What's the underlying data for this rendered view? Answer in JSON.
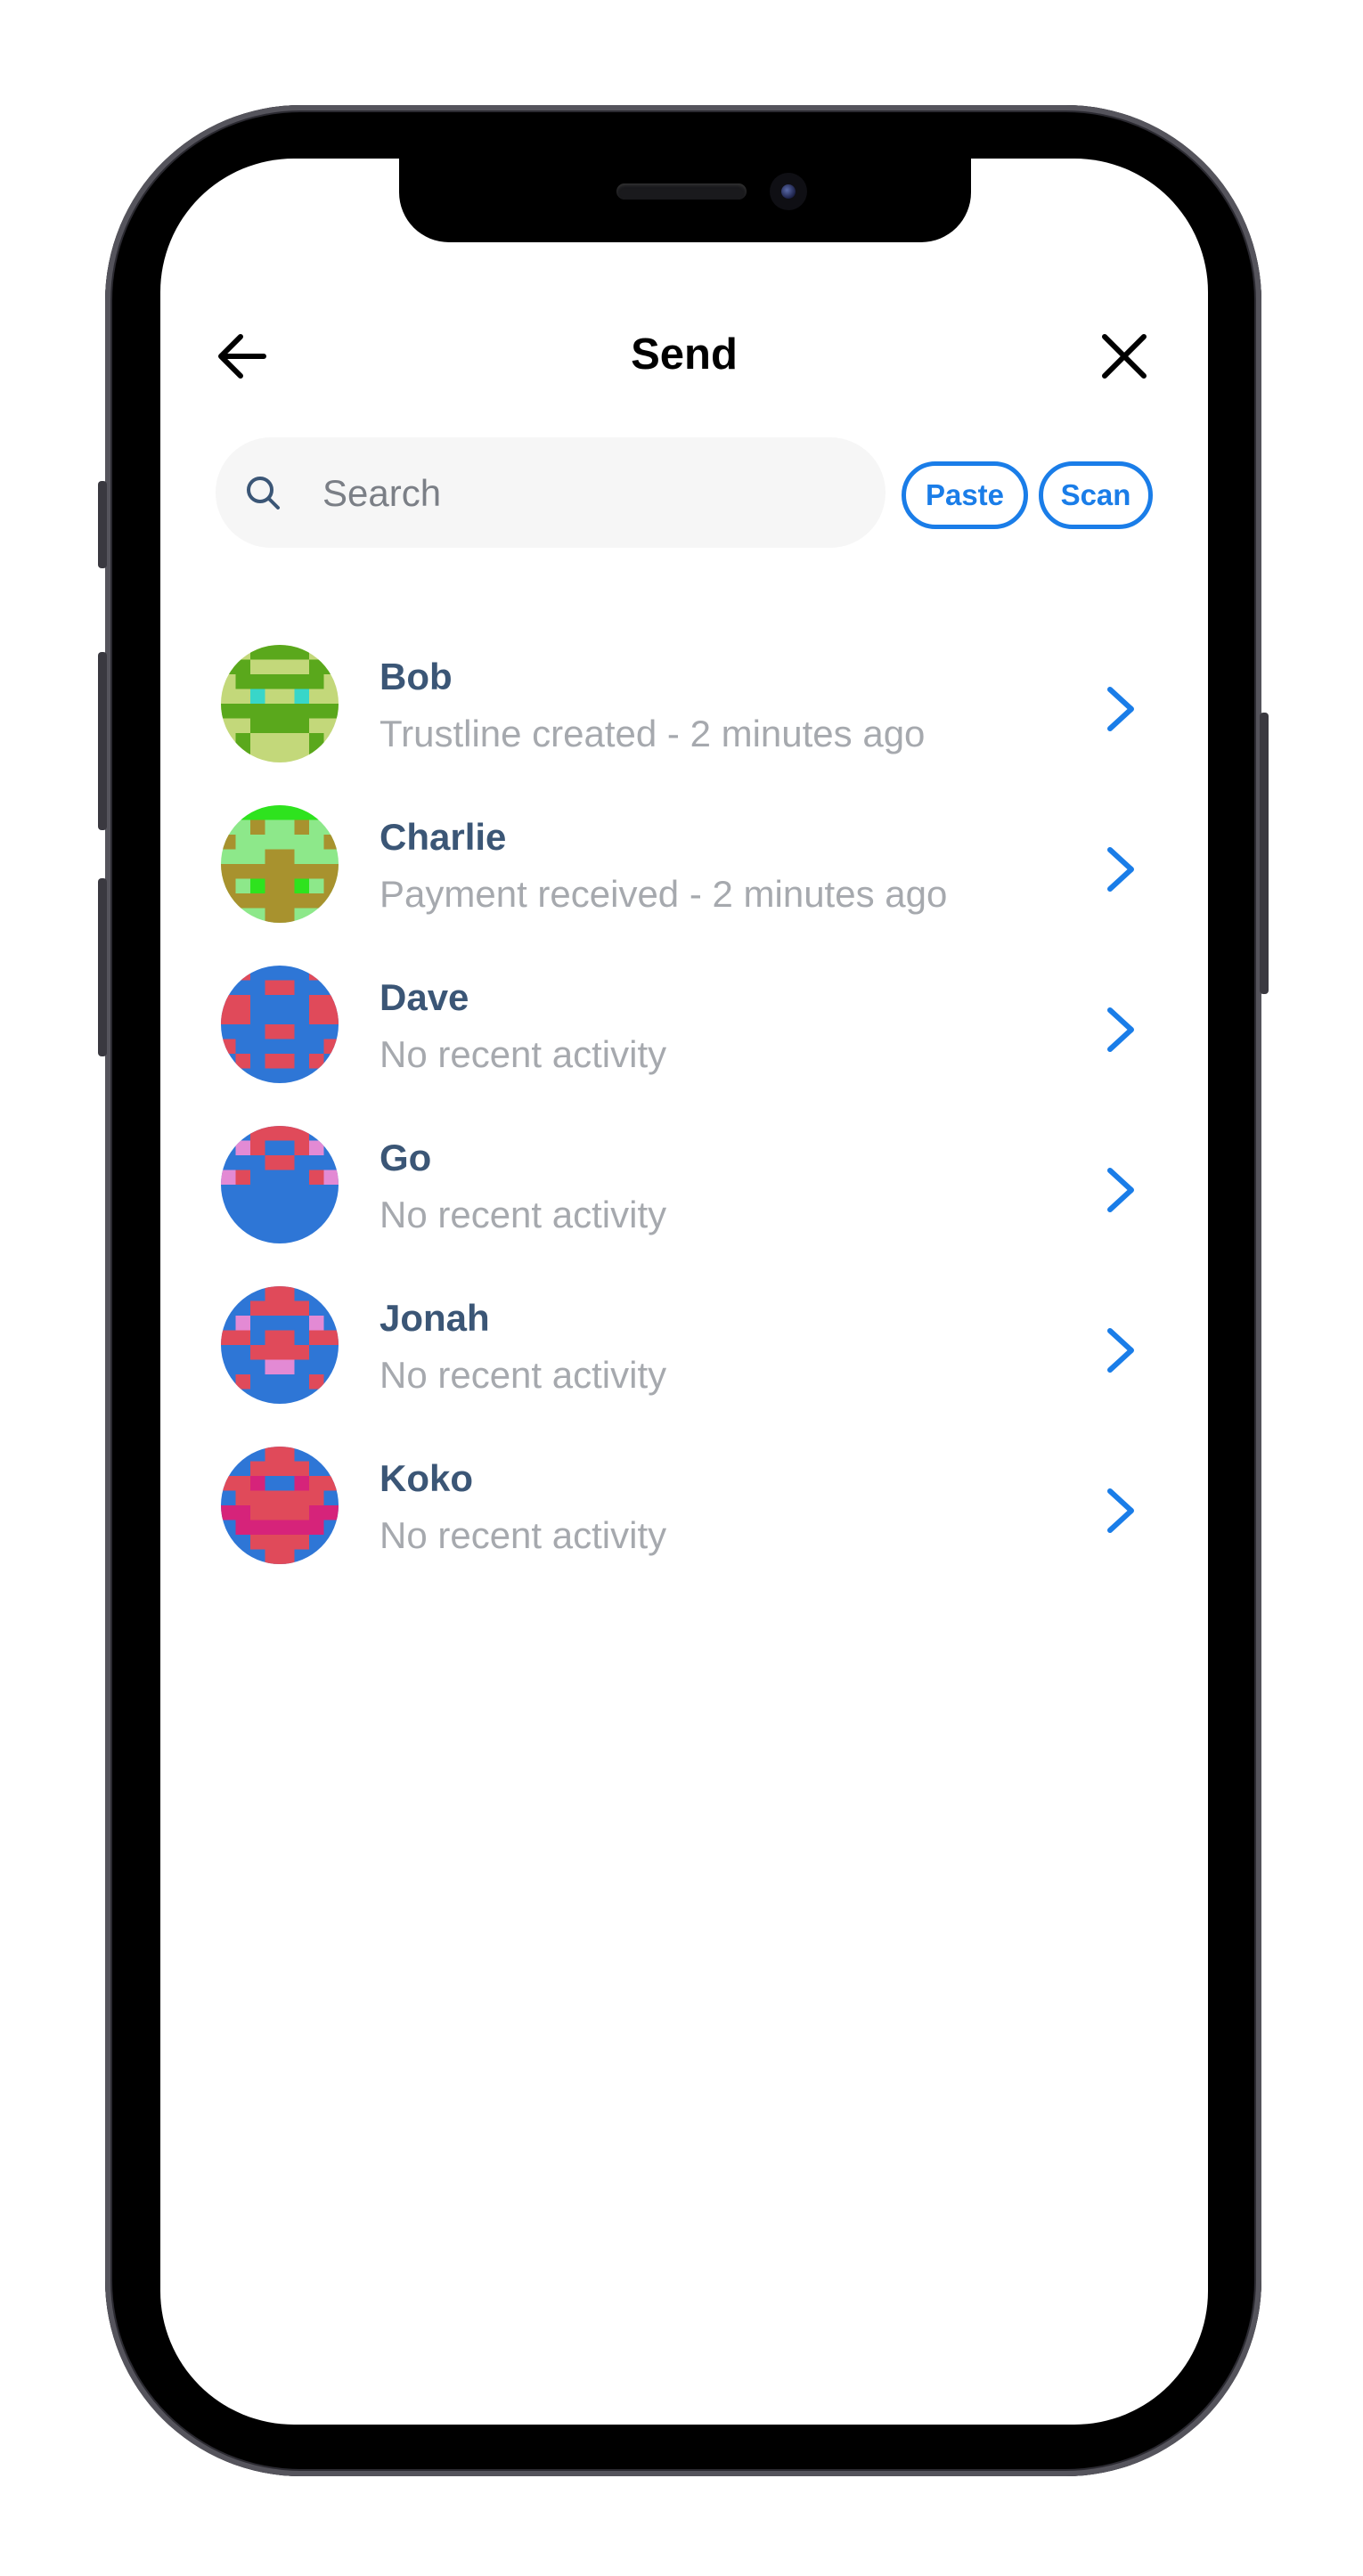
{
  "header": {
    "title": "Send"
  },
  "search": {
    "placeholder": "Search"
  },
  "actions": {
    "paste_label": "Paste",
    "scan_label": "Scan"
  },
  "accent_color": "#1a7de8",
  "contacts": [
    {
      "name": "Bob",
      "activity": "Trustline created - 2 minutes ago",
      "avatar": "green-pixel-avatar"
    },
    {
      "name": "Charlie",
      "activity": "Payment received - 2 minutes ago",
      "avatar": "olive-green-pixel-avatar"
    },
    {
      "name": "Dave",
      "activity": "No recent activity",
      "avatar": "blue-red-pixel-avatar"
    },
    {
      "name": "Go",
      "activity": "No recent activity",
      "avatar": "blue-red-pink-pixel-avatar"
    },
    {
      "name": "Jonah",
      "activity": "No recent activity",
      "avatar": "blue-red-pink-pixel-avatar"
    },
    {
      "name": "Koko",
      "activity": "No recent activity",
      "avatar": "blue-red-magenta-pixel-avatar"
    }
  ]
}
